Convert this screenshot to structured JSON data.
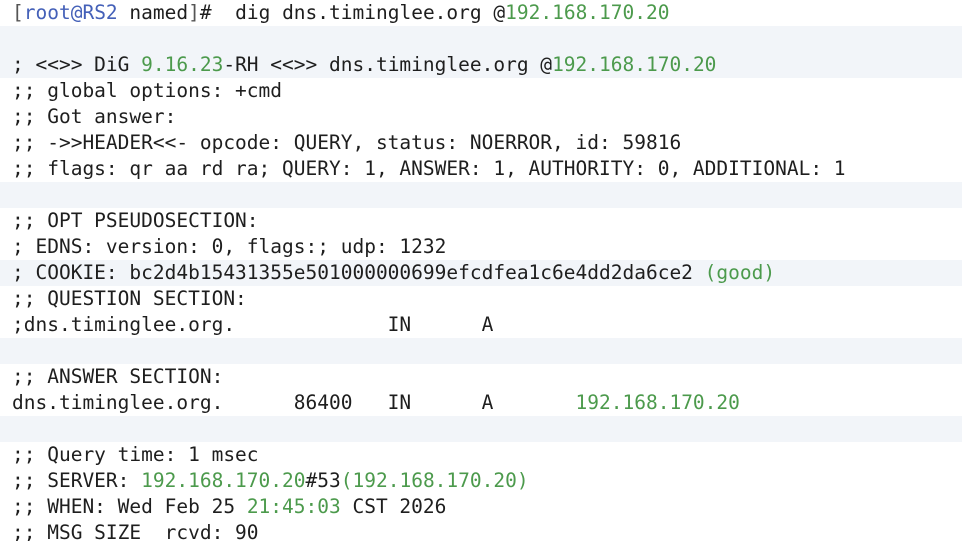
{
  "terminal": {
    "prompt": {
      "open_bracket": "[",
      "user_host": "root@RS2",
      "cwd": " named",
      "close_bracket": "]",
      "symbol": "#",
      "command": "  dig dns.timinglee.org @",
      "command_ip": "192.168.170.20"
    },
    "banner": {
      "prefix": "; <<>> DiG ",
      "version": "9.16.23",
      "suffix": "-RH <<>> dns.timinglee.org @",
      "server_ip": "192.168.170.20"
    },
    "global_options": ";; global options: +cmd",
    "got_answer": ";; Got answer:",
    "header": ";; ->>HEADER<<- opcode: QUERY, status: NOERROR, id: 59816",
    "flags": ";; flags: qr aa rd ra; QUERY: 1, ANSWER: 1, AUTHORITY: 0, ADDITIONAL: 1",
    "opt_section": ";; OPT PSEUDOSECTION:",
    "edns": "; EDNS: version: 0, flags:; udp: 1232",
    "cookie": {
      "text": "; COOKIE: bc2d4b15431355e501000000699efcdfea1c6e4dd2da6ce2 ",
      "status": "(good)"
    },
    "question_section": ";; QUESTION SECTION:",
    "question_record": ";dns.timinglee.org.             IN      A",
    "answer_section": ";; ANSWER SECTION:",
    "answer_record": {
      "text": "dns.timinglee.org.      86400   IN      A       ",
      "ip": "192.168.170.20"
    },
    "query_time": ";; Query time: 1 msec",
    "server": {
      "prefix": ";; SERVER: ",
      "ip": "192.168.170.20",
      "port": "#53",
      "open_paren": "(",
      "ip2": "192.168.170.20",
      "close_paren": ")"
    },
    "when": {
      "prefix": ";; WHEN: Wed Feb 25 ",
      "time": "21:45:03",
      "suffix": " CST 2026"
    },
    "msg_size": ";; MSG SIZE  rcvd: 90"
  },
  "colors": {
    "green": "#4c9a4c",
    "prompt_blue": "#4460b8",
    "alt_row": "#f2f5f9",
    "text": "#1e1e1e"
  }
}
